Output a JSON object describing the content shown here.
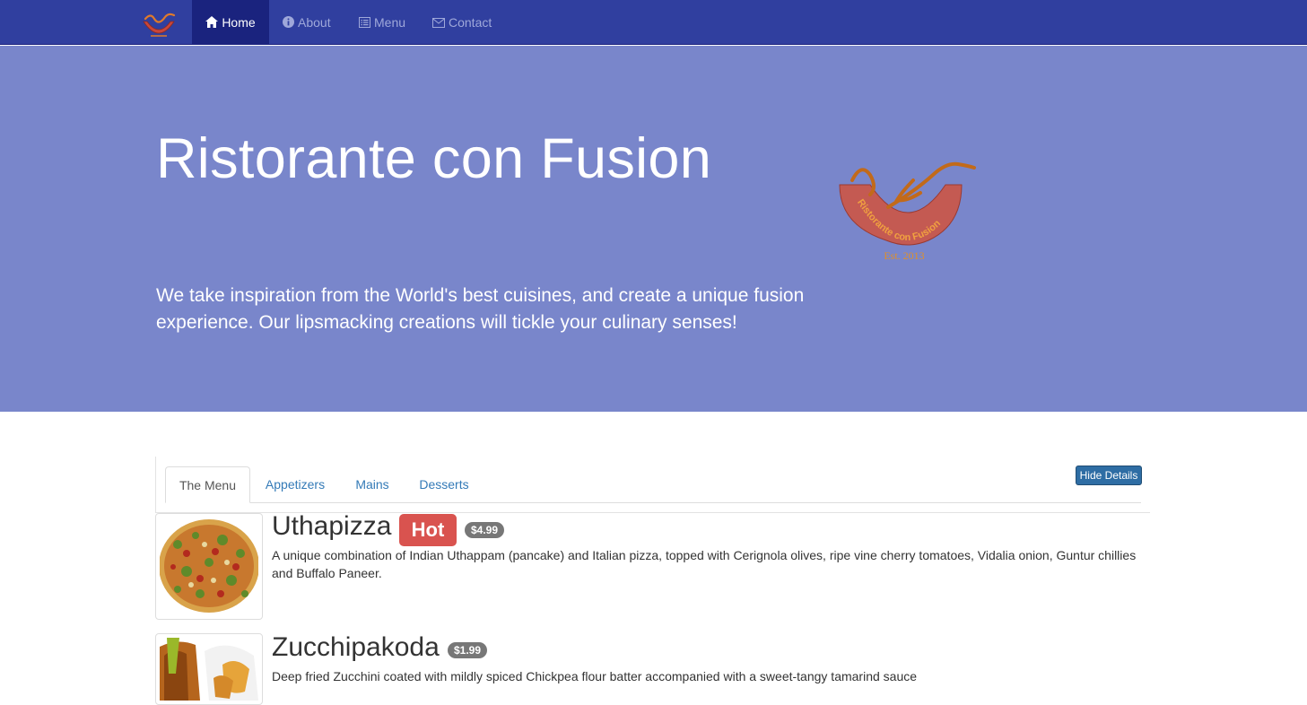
{
  "nav": {
    "items": [
      {
        "label": "Home",
        "icon": "home-icon",
        "active": true
      },
      {
        "label": "About",
        "icon": "info-circle-icon"
      },
      {
        "label": "Menu",
        "icon": "list-alt-icon"
      },
      {
        "label": "Contact",
        "icon": "envelope-icon"
      }
    ]
  },
  "jumbotron": {
    "title": "Ristorante con Fusion",
    "text": "We take inspiration from the World's best cuisines, and create a unique fusion experience. Our lipsmacking creations will tickle your culinary senses!",
    "logo_text": "Ristorante con Fusion",
    "logo_est": "Est. 2013"
  },
  "tabs": [
    {
      "label": "The Menu",
      "active": true
    },
    {
      "label": "Appetizers"
    },
    {
      "label": "Mains"
    },
    {
      "label": "Desserts"
    }
  ],
  "hide_details_label": "Hide Details",
  "dishes": [
    {
      "name": "Uthapizza",
      "label": "Hot",
      "price": "$4.99",
      "description": "A unique combination of Indian Uthappam (pancake) and Italian pizza, topped with Cerignola olives, ripe vine cherry tomatoes, Vidalia onion, Guntur chillies and Buffalo Paneer."
    },
    {
      "name": "Zucchipakoda",
      "price": "$1.99",
      "description": "Deep fried Zucchini coated with mildly spiced Chickpea flour batter accompanied with a sweet-tangy tamarind sauce"
    }
  ],
  "colors": {
    "navbar": "#303F9F",
    "navbar_active": "#1A237E",
    "jumbotron": "#7986CB",
    "hot_label": "#D9534F",
    "price_badge": "#777777",
    "link": "#337AB7"
  }
}
